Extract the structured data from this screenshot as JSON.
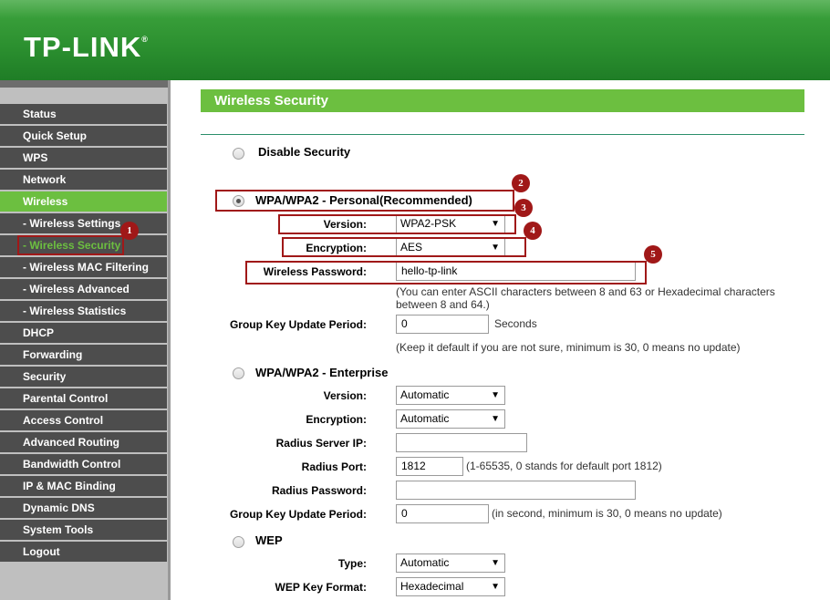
{
  "header": {
    "logo": "TP-LINK",
    "logo_mark": "®"
  },
  "sidebar": {
    "items": [
      {
        "label": "Status"
      },
      {
        "label": "Quick Setup"
      },
      {
        "label": "WPS"
      },
      {
        "label": "Network"
      },
      {
        "label": "Wireless",
        "active": true
      },
      {
        "label": "- Wireless Settings"
      },
      {
        "label": "- Wireless Security",
        "selected": true
      },
      {
        "label": "- Wireless MAC Filtering"
      },
      {
        "label": "- Wireless Advanced"
      },
      {
        "label": "- Wireless Statistics"
      },
      {
        "label": "DHCP"
      },
      {
        "label": "Forwarding"
      },
      {
        "label": "Security"
      },
      {
        "label": "Parental Control"
      },
      {
        "label": "Access Control"
      },
      {
        "label": "Advanced Routing"
      },
      {
        "label": "Bandwidth Control"
      },
      {
        "label": "IP & MAC Binding"
      },
      {
        "label": "Dynamic DNS"
      },
      {
        "label": "System Tools"
      },
      {
        "label": "Logout"
      }
    ]
  },
  "main": {
    "title": "Wireless Security",
    "disable": {
      "label": "Disable Security"
    },
    "personal": {
      "label": "WPA/WPA2 - Personal(Recommended)",
      "version_label": "Version:",
      "version_value": "WPA2-PSK",
      "encryption_label": "Encryption:",
      "encryption_value": "AES",
      "password_label": "Wireless Password:",
      "password_value": "hello-tp-link",
      "password_note_1": "(You can enter ASCII characters between 8 and 63 or Hexadecimal characters",
      "password_note_2": "between 8 and 64.)",
      "gkup_label": "Group Key Update Period:",
      "gkup_value": "0",
      "gkup_unit": "Seconds",
      "gkup_note": "(Keep it default if you are not sure, minimum is 30, 0 means no update)"
    },
    "enterprise": {
      "label": "WPA/WPA2 - Enterprise",
      "version_label": "Version:",
      "version_value": "Automatic",
      "encryption_label": "Encryption:",
      "encryption_value": "Automatic",
      "radius_ip_label": "Radius Server IP:",
      "radius_ip_value": "",
      "radius_port_label": "Radius Port:",
      "radius_port_value": "1812",
      "radius_port_note": "(1-65535, 0 stands for default port 1812)",
      "radius_pw_label": "Radius Password:",
      "radius_pw_value": "",
      "gkup_label": "Group Key Update Period:",
      "gkup_value": "0",
      "gkup_note": "(in second, minimum is 30, 0 means no update)"
    },
    "wep": {
      "label": "WEP",
      "type_label": "Type:",
      "type_value": "Automatic",
      "format_label": "WEP Key Format:",
      "format_value": "Hexadecimal"
    }
  },
  "annotations": [
    "1",
    "2",
    "3",
    "4",
    "5"
  ],
  "icons": {
    "select_arrow": "▼",
    "radio": "radio-icon"
  },
  "colors": {
    "accent": "#6cbf40",
    "header": "#2b8f2f",
    "annotation": "#a01818",
    "sidebar_item": "#4d4d4d"
  }
}
